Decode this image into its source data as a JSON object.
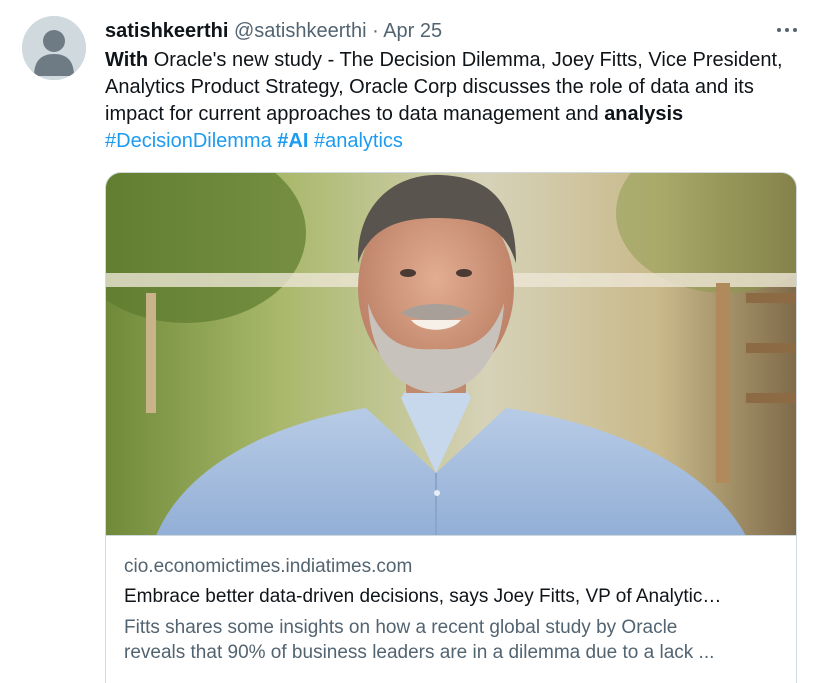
{
  "tweet": {
    "display_name": "satishkeerthi",
    "handle": "@satishkeerthi",
    "separator": "·",
    "date": "Apr 25",
    "more_icon": "more-horizontal-icon",
    "text": {
      "bold_lead": "With",
      "body": " Oracle's new study - The Decision Dilemma, Joey Fitts, Vice President, Analytics Product Strategy, Oracle Corp discusses the role of data and its impact for current approaches to data management and ",
      "bold_tail": "analysis",
      "hashtags": [
        "#DecisionDilemma",
        "#AI",
        "#analytics"
      ]
    }
  },
  "card": {
    "image_icon": "portrait-photo",
    "domain": "cio.economictimes.indiatimes.com",
    "title": "Embrace better data-driven decisions, says Joey Fitts, VP of Analytic…",
    "description_line1": "Fitts shares some insights on how a recent global study by Oracle",
    "description_line2": "reveals that 90% of business leaders are in a dilemma due to a lack ..."
  },
  "colors": {
    "link": "#1d9bf0",
    "secondary": "#536471",
    "primary": "#0f1419",
    "border": "#cfd9de"
  }
}
